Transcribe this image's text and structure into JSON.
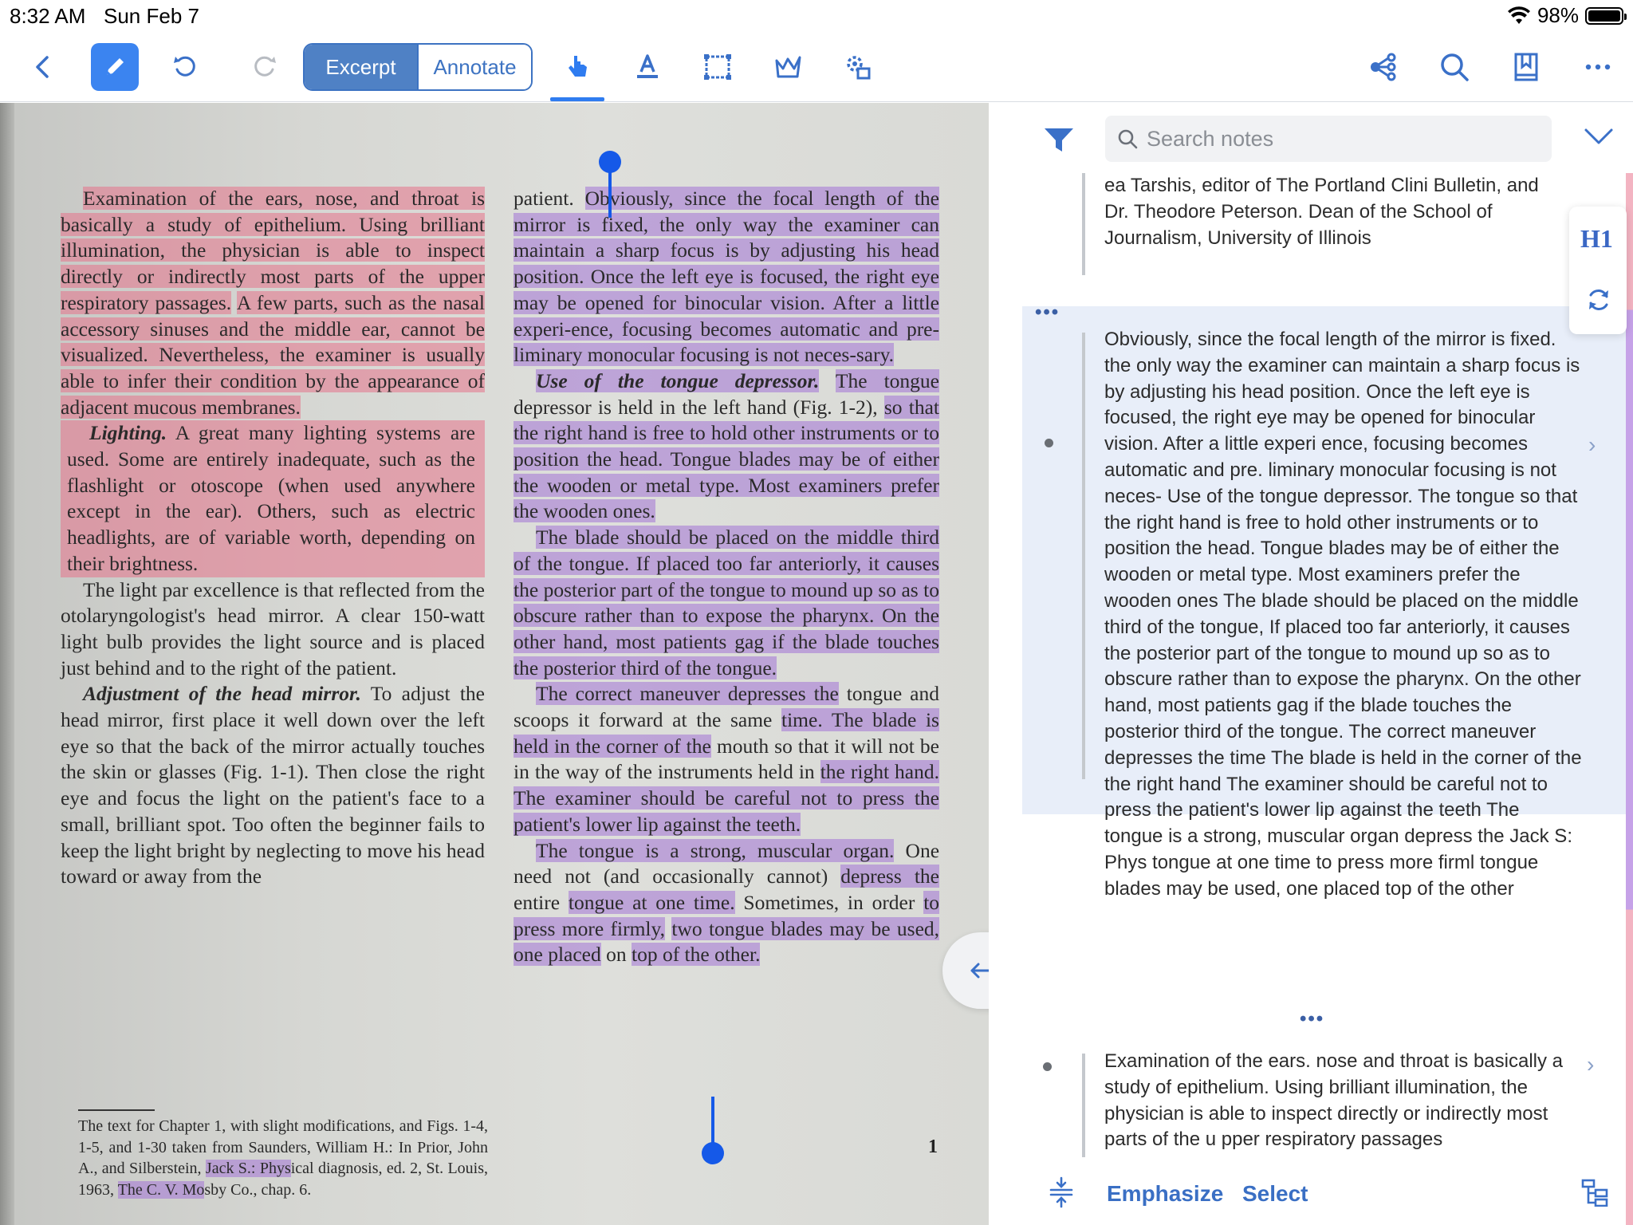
{
  "status": {
    "time": "8:32 AM",
    "date": "Sun Feb 7",
    "battery": "98%"
  },
  "toolbar": {
    "segments": [
      "Excerpt",
      "Annotate"
    ],
    "icons": [
      "back-icon",
      "pen-icon",
      "undo-icon",
      "redo-icon",
      "hand-pointer-icon",
      "text-highlight-icon",
      "rect-select-icon",
      "lasso-icon",
      "settings-gear-icon",
      "mindmap-icon",
      "search-icon",
      "bookmark-icon",
      "more-icon"
    ]
  },
  "doc": {
    "col1": [
      {
        "style": "red",
        "text": "Examination of the ears, nose, and throat is basically a study of epithelium. Using brilliant illumination, the physician is able to inspect directly or indirectly most parts of the upper respiratory passages."
      },
      {
        "style": "red-cont",
        "text": "A few parts, such as the nasal accessory sinuses and the middle ear, cannot be visualized. Nevertheless, the examiner is usually able to infer their condition by the appearance of adjacent mucous membranes."
      },
      {
        "style": "redblock",
        "head": "Lighting.",
        "text": "A great many lighting systems are used. Some are entirely inadequate, such as the flashlight or otoscope (when used anywhere except in the ear). Others, such as electric headlights, are of variable worth, depending on their brightness."
      },
      {
        "style": "plain",
        "text": "The light par excellence is that reflected from the otolaryngologist's head mirror. A clear 150-watt light bulb provides the light source and is placed just behind and to the right of the patient."
      },
      {
        "style": "plain-head",
        "head": "Adjustment of the head mirror.",
        "text": "To adjust the head mirror, first place it well down over the left eye so that the back of the mirror actually touches the skin or glasses (Fig. 1-1). Then close the right eye and focus the light on the patient's face to a small, brilliant spot. Too often the beginner fails to keep the light bright by neglecting to move his head toward or away from the"
      }
    ],
    "col2": {
      "p1_plain": "patient.",
      "p1_hl": "Obviously, since the focal length of the mirror is fixed, the only way the examiner can maintain a sharp focus is by adjusting his head position. Once the left eye is focused, the right eye may be opened for binocular vision. After a little experi-ence, focusing becomes automatic and pre-liminary monocular focusing is not neces-sary.",
      "p2_head": "Use of the tongue depressor.",
      "p2_hl1": "The tongue",
      "p2_plain": "depressor is held in the left hand (Fig. 1-2),",
      "p2_hl2": "so that the right hand is free to hold other instruments or to position the head. Tongue blades may be of either the wooden or metal type. Most examiners prefer the wooden ones.",
      "p3_hl": "The blade should be placed on the middle third of the tongue. If placed too far anteriorly, it causes the posterior part of the tongue to mound up so as to obscure rather than to expose the pharynx. On the other hand, most patients gag if the blade touches the posterior third of the tongue.",
      "p4_hl1": "The correct maneuver depresses the",
      "p4_plain1": "tongue and scoops it forward at the same",
      "p4_hl2": "time. The blade is held in the corner of the",
      "p4_plain2": "mouth so that it will not be in the way of the instruments held in",
      "p4_hl3": "the right hand. The examiner should be careful not to press the patient's lower lip against the teeth.",
      "p5_hl1": "The tongue is a strong, muscular organ.",
      "p5_plain1": "One need not (and occasionally cannot)",
      "p5_hl2": "depress the",
      "p5_plain2": "entire",
      "p5_hl3": "tongue at one time.",
      "p5_plain3": "Sometimes, in order",
      "p5_hl4": "to press more firmly,",
      "p5_hl5": "two tongue blades may be used, one placed",
      "p5_plain4": "on",
      "p5_hl6": "top of the other."
    },
    "footnote_pre": "The text for Chapter 1, with slight modifications, and Figs. 1-4, 1-5, and 1-30 taken from Saunders, William H.: In Prior, John A., and Silberstein,",
    "footnote_hl": "Jack S.: Phys",
    "footnote_mid": "ical diagnosis, ed. 2, St. Louis, 1963,",
    "footnote_hl2": "The C. V. Mo",
    "footnote_post": "sby Co., chap. 6.",
    "page_number": "1"
  },
  "notes": {
    "search_placeholder": "Search notes",
    "note0": "ea Tarshis, editor of The Portland Clini  Bulletin, and Dr. Theodore Peterson. Dean  of the School of Journalism, University of  Illinois",
    "note1": "Obviously, since the focal length  of the mirror is fixed. the only way the  examiner can maintain a sharp focus is by  adjusting his head position. Once the left  eye is focused, the right eye may be opened for binocular vision. After a little experi  ence, focusing becomes automatic and pre.  liminary monocular focusing is not neces-  Use of the tongue depressor. The tongue  so that the right hand is free to hold other  instruments or to position the head. Tongue  blades may be of either the wooden or  metal type. Most examiners prefer the  wooden ones  The blade should be placed on the  middle third of the tongue, If placed too  far anteriorly, it causes the posterior part  of the tongue to mound up so as to obscure  rather than to expose the pharynx. On the  other hand, most patients gag if the blade touches the posterior third of the tongue.  The correct maneuver depresses the  time The blade is held in the corner of the  the right hand  The examiner should be careful not to press  the patient's lower lip against the teeth  The tongue is a strong, muscular organ  depress the  Jack S: Phys  tongue at one time  to press more firml  tongue blades may be used, one placed  top of the other",
    "note2": "Examination of the ears. nose and throat  is basically a study of epithelium. Using  brilliant illumination, the physician is able  to inspect directly or indirectly most parts  of the u  pper respiratory passages",
    "more_dots": "•••",
    "h1_label": "H1",
    "emphasize": "Emphasize",
    "select": "Select"
  }
}
